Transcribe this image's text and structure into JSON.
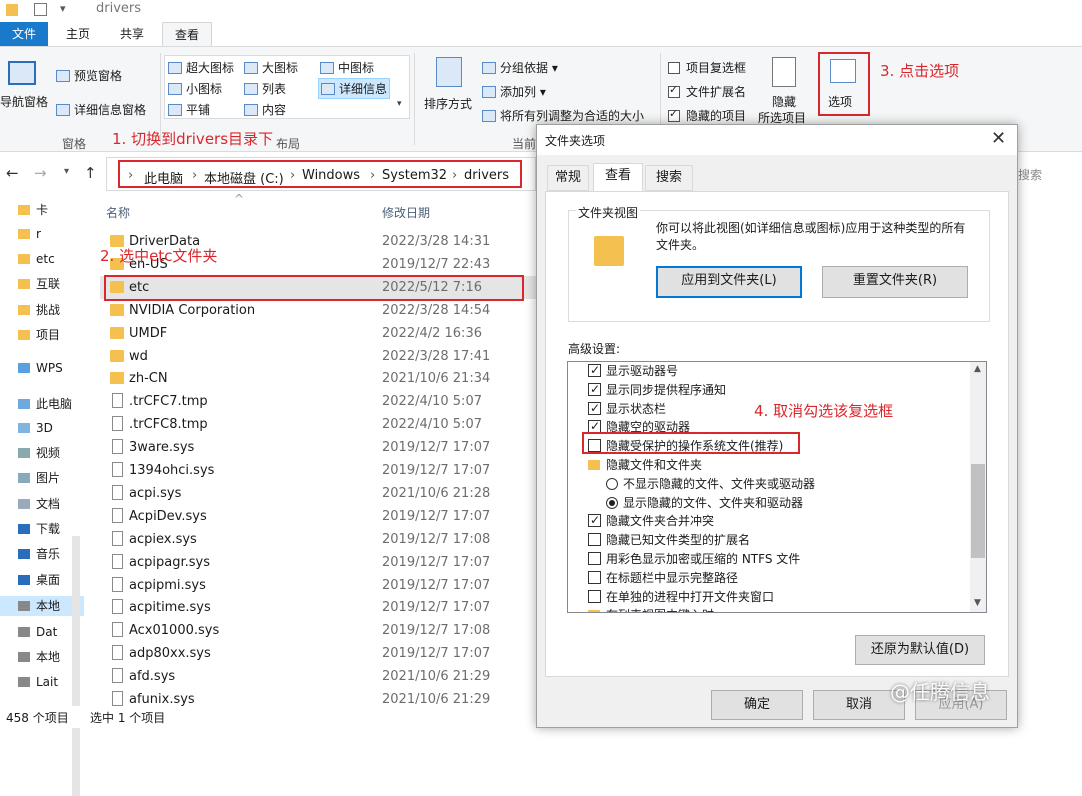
{
  "window": {
    "title": "drivers"
  },
  "ribbon_tabs": [
    {
      "label": "文件"
    },
    {
      "label": "主页"
    },
    {
      "label": "共享"
    },
    {
      "label": "查看"
    }
  ],
  "ribbon": {
    "nav_pane": "导航窗格",
    "preview_pane": "预览窗格",
    "details_pane": "详细信息窗格",
    "group_panes": "窗格",
    "layout": [
      "超大图标",
      "大图标",
      "中图标",
      "小图标",
      "列表",
      "详细信息",
      "平铺",
      "内容"
    ],
    "group_layout": "布局",
    "sort_by": "排序方式",
    "group_by": "分组依据",
    "add_columns": "添加列",
    "fit_columns": "将所有列调整为合适的大小",
    "group_current": "当前",
    "item_checkboxes": "项目复选框",
    "file_extensions": "文件扩展名",
    "hidden_items": "隐藏的项目",
    "hide": "隐藏",
    "hide_selected": "所选项目",
    "options": "选项"
  },
  "annotations": {
    "step1": "1. 切换到drivers目录下",
    "step2": "2. 选中etc文件夹",
    "step3": "3. 点击选项",
    "step4": "4. 取消勾选该复选框"
  },
  "address": {
    "crumbs": [
      "此电脑",
      "本地磁盘 (C:)",
      "Windows",
      "System32",
      "drivers"
    ],
    "search_placeholder": "搜索"
  },
  "nav": {
    "items": [
      "卡",
      "r",
      "etc",
      "互联",
      "挑战",
      "项目",
      "WPS",
      "此电脑",
      "3D",
      "视频",
      "图片",
      "文档",
      "下载",
      "音乐",
      "桌面",
      "本地",
      "Dat",
      "本地",
      "Lait"
    ]
  },
  "list": {
    "col_name": "名称",
    "col_date": "修改日期",
    "rows": [
      {
        "name": "DriverData",
        "date": "2022/3/28 14:31",
        "type": "folder"
      },
      {
        "name": "en-US",
        "date": "2019/12/7 22:43",
        "type": "folder"
      },
      {
        "name": "etc",
        "date": "2022/5/12 7:16",
        "type": "folder"
      },
      {
        "name": "NVIDIA Corporation",
        "date": "2022/3/28 14:54",
        "type": "folder"
      },
      {
        "name": "UMDF",
        "date": "2022/4/2 16:36",
        "type": "folder"
      },
      {
        "name": "wd",
        "date": "2022/3/28 17:41",
        "type": "folder"
      },
      {
        "name": "zh-CN",
        "date": "2021/10/6 21:34",
        "type": "folder"
      },
      {
        "name": ".trCFC7.tmp",
        "date": "2022/4/10 5:07",
        "type": "file"
      },
      {
        "name": ".trCFC8.tmp",
        "date": "2022/4/10 5:07",
        "type": "file"
      },
      {
        "name": "3ware.sys",
        "date": "2019/12/7 17:07",
        "type": "file"
      },
      {
        "name": "1394ohci.sys",
        "date": "2019/12/7 17:07",
        "type": "file"
      },
      {
        "name": "acpi.sys",
        "date": "2021/10/6 21:28",
        "type": "file"
      },
      {
        "name": "AcpiDev.sys",
        "date": "2019/12/7 17:07",
        "type": "file"
      },
      {
        "name": "acpiex.sys",
        "date": "2019/12/7 17:08",
        "type": "file"
      },
      {
        "name": "acpipagr.sys",
        "date": "2019/12/7 17:07",
        "type": "file"
      },
      {
        "name": "acpipmi.sys",
        "date": "2019/12/7 17:07",
        "type": "file"
      },
      {
        "name": "acpitime.sys",
        "date": "2019/12/7 17:07",
        "type": "file"
      },
      {
        "name": "Acx01000.sys",
        "date": "2019/12/7 17:08",
        "type": "file"
      },
      {
        "name": "adp80xx.sys",
        "date": "2019/12/7 17:07",
        "type": "file"
      },
      {
        "name": "afd.sys",
        "date": "2021/10/6 21:29",
        "type": "file"
      },
      {
        "name": "afunix.sys",
        "date": "2021/10/6 21:29",
        "type": "file"
      }
    ]
  },
  "status": {
    "count": "458 个项目",
    "selected": "选中 1 个项目"
  },
  "dialog": {
    "title": "文件夹选项",
    "tabs": [
      "常规",
      "查看",
      "搜索"
    ],
    "folder_views_title": "文件夹视图",
    "folder_views_desc": "你可以将此视图(如详细信息或图标)应用于这种类型的所有文件夹。",
    "apply_btn": "应用到文件夹(L)",
    "reset_btn": "重置文件夹(R)",
    "advanced_label": "高级设置:",
    "options": [
      {
        "label": "显示驱动器号",
        "kind": "check",
        "checked": true
      },
      {
        "label": "显示同步提供程序通知",
        "kind": "check",
        "checked": true
      },
      {
        "label": "显示状态栏",
        "kind": "check",
        "checked": true
      },
      {
        "label": "隐藏空的驱动器",
        "kind": "check",
        "checked": true
      },
      {
        "label": "隐藏受保护的操作系统文件(推荐)",
        "kind": "check",
        "checked": false
      },
      {
        "label": "隐藏文件和文件夹",
        "kind": "folder"
      },
      {
        "label": "不显示隐藏的文件、文件夹或驱动器",
        "kind": "radio",
        "checked": false
      },
      {
        "label": "显示隐藏的文件、文件夹和驱动器",
        "kind": "radio",
        "checked": true
      },
      {
        "label": "隐藏文件夹合并冲突",
        "kind": "check",
        "checked": true
      },
      {
        "label": "隐藏已知文件类型的扩展名",
        "kind": "check",
        "checked": false
      },
      {
        "label": "用彩色显示加密或压缩的 NTFS 文件",
        "kind": "check",
        "checked": false
      },
      {
        "label": "在标题栏中显示完整路径",
        "kind": "check",
        "checked": false
      },
      {
        "label": "在单独的进程中打开文件夹窗口",
        "kind": "check",
        "checked": false
      },
      {
        "label": "在列表视图中键入时",
        "kind": "folder"
      }
    ],
    "restore_btn": "还原为默认值(D)",
    "ok_btn": "确定",
    "cancel_btn": "取消",
    "apply_main_btn": "应用(A)"
  },
  "watermark": "@任腾信息"
}
